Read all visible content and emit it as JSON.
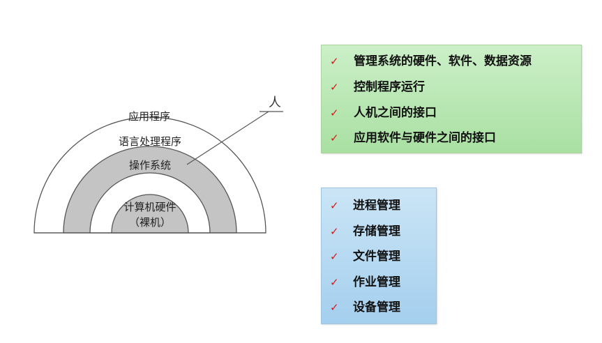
{
  "diagram": {
    "layers": {
      "outer": "应用程序",
      "second": "语言处理程序",
      "third": "操作系统",
      "core_line1": "计算机硬件",
      "core_line2": "（裸机）"
    },
    "person_label": "人",
    "colors": {
      "ring_gray": "#c4c4c4",
      "ring_white": "#ffffff",
      "stroke": "#555555"
    }
  },
  "os_functions": {
    "check_icon": "checkmark-icon",
    "items": [
      "管理系统的硬件、软件、数据资源",
      "控制程序运行",
      "人机之间的接口",
      "应用软件与硬件之间的接口"
    ],
    "background": "#b8e6b2"
  },
  "os_management": {
    "check_icon": "checkmark-icon",
    "items": [
      "进程管理",
      "存储管理",
      "文件管理",
      "作业管理",
      "设备管理"
    ],
    "background": "#b4d9f2"
  }
}
